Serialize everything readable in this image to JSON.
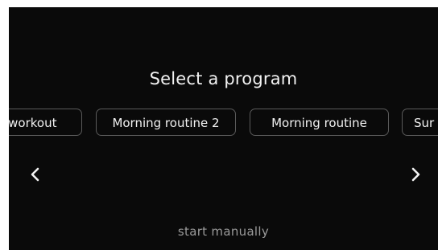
{
  "screen": {
    "title": "Select a program",
    "programs": [
      "er workout",
      "Morning routine 2",
      "Morning routine",
      "Sur"
    ],
    "prev_icon": "chevron-left-icon",
    "next_icon": "chevron-right-icon",
    "start_manually_label": "start manually"
  },
  "colors": {
    "background": "#0a0a0a",
    "text": "#f2f2f2",
    "chip_border": "#5a5a5a",
    "muted_text": "#9a9a9a"
  }
}
